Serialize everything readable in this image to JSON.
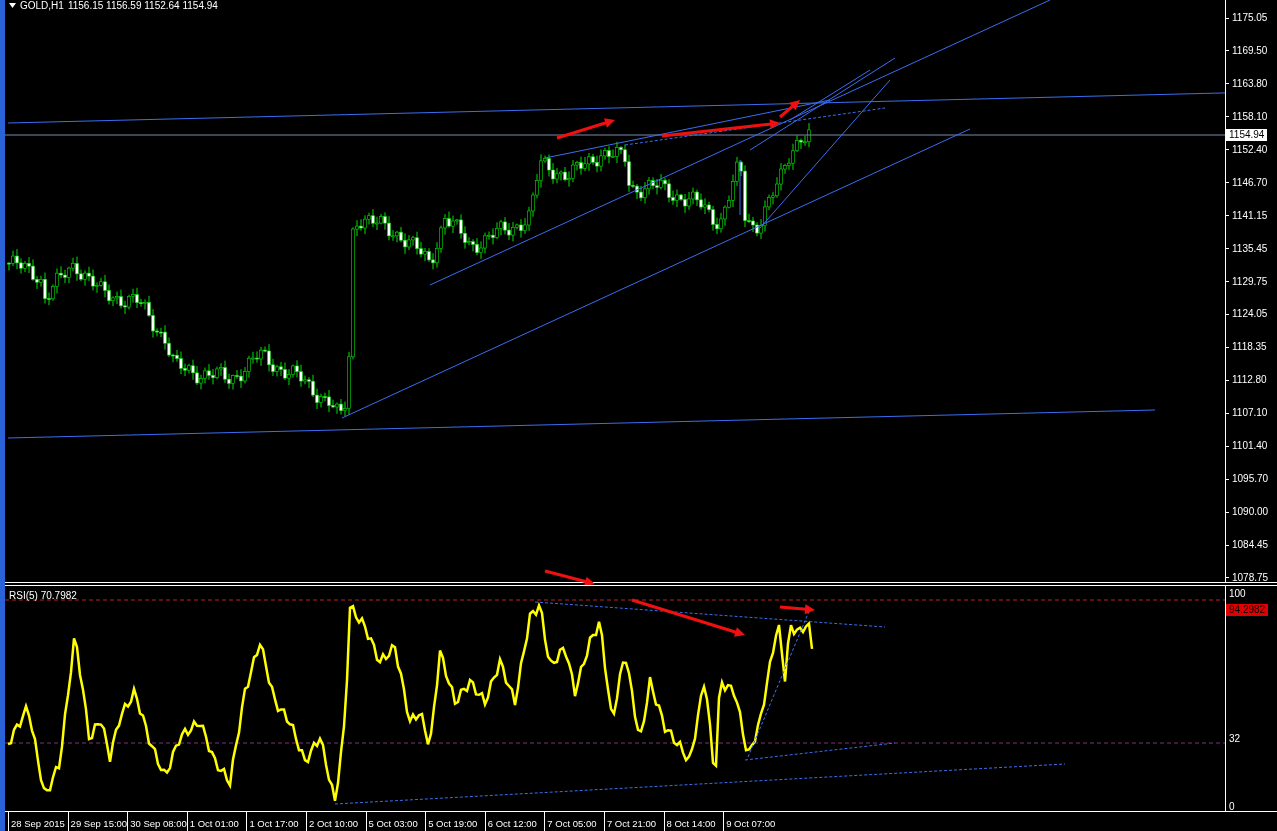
{
  "chart": {
    "symbol": "GOLD,H1",
    "ohlc": "1156.15 1156.59 1152.64 1154.94",
    "current_price": "1154.94",
    "price_axis": [
      "1175.05",
      "1169.50",
      "1163.80",
      "1158.10",
      "1152.40",
      "1146.70",
      "1141.15",
      "1135.45",
      "1129.75",
      "1124.05",
      "1118.35",
      "1112.80",
      "1107.10",
      "1101.40",
      "1095.70",
      "1090.00",
      "1084.45",
      "1078.75"
    ]
  },
  "indicator": {
    "title": "RSI(5) 70.7982",
    "axis": [
      {
        "label": "100",
        "kind": "tick"
      },
      {
        "label": "94.2982",
        "kind": "badge"
      },
      {
        "label": "32",
        "kind": "tick"
      },
      {
        "label": "0",
        "kind": "tick"
      }
    ]
  },
  "time_axis": [
    "28 Sep 2015",
    "29 Sep 15:00",
    "30 Sep 08:00",
    "1 Oct 01:00",
    "1 Oct 17:00",
    "2 Oct 10:00",
    "5 Oct 03:00",
    "5 Oct 19:00",
    "6 Oct 12:00",
    "7 Oct 05:00",
    "7 Oct 21:00",
    "8 Oct 14:00",
    "9 Oct 07:00"
  ]
}
